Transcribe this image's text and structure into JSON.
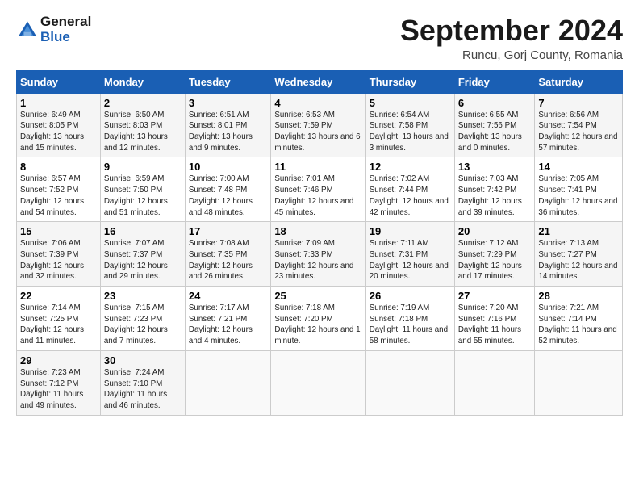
{
  "header": {
    "logo_line1": "General",
    "logo_line2": "Blue",
    "month": "September 2024",
    "location": "Runcu, Gorj County, Romania"
  },
  "days_of_week": [
    "Sunday",
    "Monday",
    "Tuesday",
    "Wednesday",
    "Thursday",
    "Friday",
    "Saturday"
  ],
  "weeks": [
    [
      {
        "num": "1",
        "sunrise": "6:49 AM",
        "sunset": "8:05 PM",
        "daylight": "13 hours and 15 minutes."
      },
      {
        "num": "2",
        "sunrise": "6:50 AM",
        "sunset": "8:03 PM",
        "daylight": "13 hours and 12 minutes."
      },
      {
        "num": "3",
        "sunrise": "6:51 AM",
        "sunset": "8:01 PM",
        "daylight": "13 hours and 9 minutes."
      },
      {
        "num": "4",
        "sunrise": "6:53 AM",
        "sunset": "7:59 PM",
        "daylight": "13 hours and 6 minutes."
      },
      {
        "num": "5",
        "sunrise": "6:54 AM",
        "sunset": "7:58 PM",
        "daylight": "13 hours and 3 minutes."
      },
      {
        "num": "6",
        "sunrise": "6:55 AM",
        "sunset": "7:56 PM",
        "daylight": "13 hours and 0 minutes."
      },
      {
        "num": "7",
        "sunrise": "6:56 AM",
        "sunset": "7:54 PM",
        "daylight": "12 hours and 57 minutes."
      }
    ],
    [
      {
        "num": "8",
        "sunrise": "6:57 AM",
        "sunset": "7:52 PM",
        "daylight": "12 hours and 54 minutes."
      },
      {
        "num": "9",
        "sunrise": "6:59 AM",
        "sunset": "7:50 PM",
        "daylight": "12 hours and 51 minutes."
      },
      {
        "num": "10",
        "sunrise": "7:00 AM",
        "sunset": "7:48 PM",
        "daylight": "12 hours and 48 minutes."
      },
      {
        "num": "11",
        "sunrise": "7:01 AM",
        "sunset": "7:46 PM",
        "daylight": "12 hours and 45 minutes."
      },
      {
        "num": "12",
        "sunrise": "7:02 AM",
        "sunset": "7:44 PM",
        "daylight": "12 hours and 42 minutes."
      },
      {
        "num": "13",
        "sunrise": "7:03 AM",
        "sunset": "7:42 PM",
        "daylight": "12 hours and 39 minutes."
      },
      {
        "num": "14",
        "sunrise": "7:05 AM",
        "sunset": "7:41 PM",
        "daylight": "12 hours and 36 minutes."
      }
    ],
    [
      {
        "num": "15",
        "sunrise": "7:06 AM",
        "sunset": "7:39 PM",
        "daylight": "12 hours and 32 minutes."
      },
      {
        "num": "16",
        "sunrise": "7:07 AM",
        "sunset": "7:37 PM",
        "daylight": "12 hours and 29 minutes."
      },
      {
        "num": "17",
        "sunrise": "7:08 AM",
        "sunset": "7:35 PM",
        "daylight": "12 hours and 26 minutes."
      },
      {
        "num": "18",
        "sunrise": "7:09 AM",
        "sunset": "7:33 PM",
        "daylight": "12 hours and 23 minutes."
      },
      {
        "num": "19",
        "sunrise": "7:11 AM",
        "sunset": "7:31 PM",
        "daylight": "12 hours and 20 minutes."
      },
      {
        "num": "20",
        "sunrise": "7:12 AM",
        "sunset": "7:29 PM",
        "daylight": "12 hours and 17 minutes."
      },
      {
        "num": "21",
        "sunrise": "7:13 AM",
        "sunset": "7:27 PM",
        "daylight": "12 hours and 14 minutes."
      }
    ],
    [
      {
        "num": "22",
        "sunrise": "7:14 AM",
        "sunset": "7:25 PM",
        "daylight": "12 hours and 11 minutes."
      },
      {
        "num": "23",
        "sunrise": "7:15 AM",
        "sunset": "7:23 PM",
        "daylight": "12 hours and 7 minutes."
      },
      {
        "num": "24",
        "sunrise": "7:17 AM",
        "sunset": "7:21 PM",
        "daylight": "12 hours and 4 minutes."
      },
      {
        "num": "25",
        "sunrise": "7:18 AM",
        "sunset": "7:20 PM",
        "daylight": "12 hours and 1 minute."
      },
      {
        "num": "26",
        "sunrise": "7:19 AM",
        "sunset": "7:18 PM",
        "daylight": "11 hours and 58 minutes."
      },
      {
        "num": "27",
        "sunrise": "7:20 AM",
        "sunset": "7:16 PM",
        "daylight": "11 hours and 55 minutes."
      },
      {
        "num": "28",
        "sunrise": "7:21 AM",
        "sunset": "7:14 PM",
        "daylight": "11 hours and 52 minutes."
      }
    ],
    [
      {
        "num": "29",
        "sunrise": "7:23 AM",
        "sunset": "7:12 PM",
        "daylight": "11 hours and 49 minutes."
      },
      {
        "num": "30",
        "sunrise": "7:24 AM",
        "sunset": "7:10 PM",
        "daylight": "11 hours and 46 minutes."
      },
      null,
      null,
      null,
      null,
      null
    ]
  ]
}
